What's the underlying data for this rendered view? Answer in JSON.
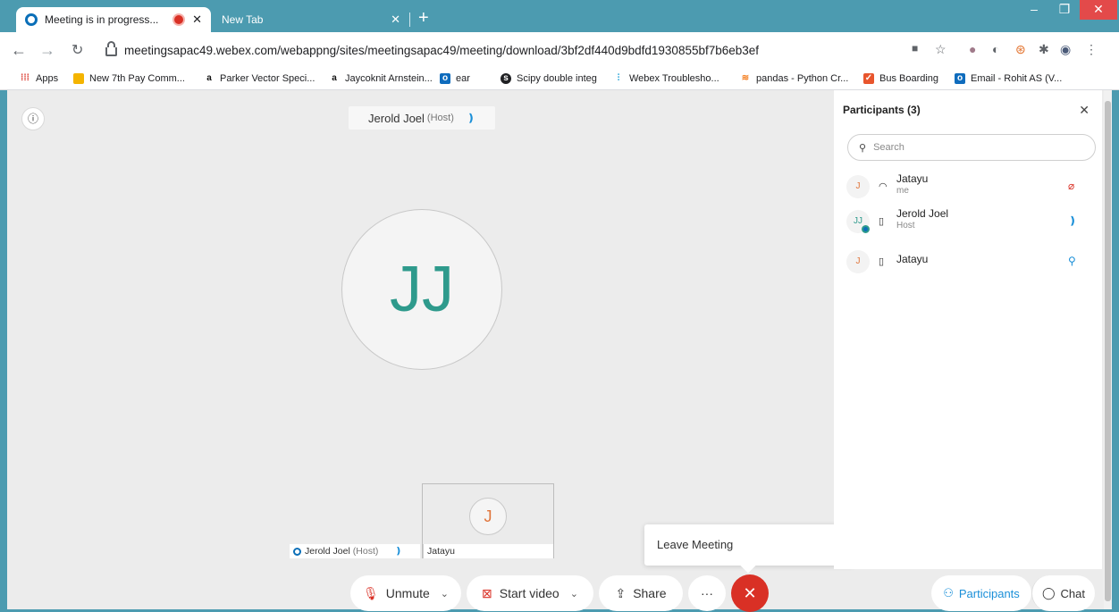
{
  "browser": {
    "tabs": [
      {
        "label": "Meeting is in progress..."
      },
      {
        "label": "New Tab"
      }
    ],
    "url": "meetingsapac49.webex.com/webappng/sites/meetingsapac49/meeting/download/3bf2df440d9bdfd1930855bf7b6eb3ef",
    "bookmarks": [
      {
        "label": "Apps"
      },
      {
        "label": "New 7th Pay Comm..."
      },
      {
        "label": "Parker Vector Speci..."
      },
      {
        "label": "Jaycoknit Arnstein..."
      },
      {
        "label": "ear"
      },
      {
        "label": "Scipy double integ"
      },
      {
        "label": "Webex Troublesho..."
      },
      {
        "label": "pandas - Python Cr..."
      },
      {
        "label": "Bus Boarding"
      },
      {
        "label": "Email - Rohit AS (V..."
      }
    ]
  },
  "meeting": {
    "active_speaker": {
      "name": "Jerold Joel",
      "role": "(Host)",
      "initials": "JJ"
    },
    "self_view": {
      "initials": "J",
      "name": "Jatayu"
    },
    "host_strip": {
      "name": "Jerold Joel",
      "role": "(Host)"
    },
    "tooltip": "Leave Meeting",
    "controls": {
      "unmute": "Unmute",
      "start_video": "Start video",
      "share": "Share",
      "more": "···",
      "leave_symbol": "✕",
      "participants": "Participants",
      "chat": "Chat"
    }
  },
  "participants_panel": {
    "title": "Participants (3)",
    "search_placeholder": "Search",
    "items": [
      {
        "initials": "J",
        "name": "Jatayu",
        "sub": "me",
        "mic": "muted"
      },
      {
        "initials": "JJ",
        "name": "Jerold Joel",
        "sub": "Host",
        "mic": "speaking"
      },
      {
        "initials": "J",
        "name": "Jatayu",
        "sub": "",
        "mic": "unmuted"
      }
    ]
  },
  "colors": {
    "accent": "#2e9a8c",
    "leave_red": "#d93025",
    "browser_frame": "#4c9bb0",
    "link_blue": "#1a8fd8"
  }
}
